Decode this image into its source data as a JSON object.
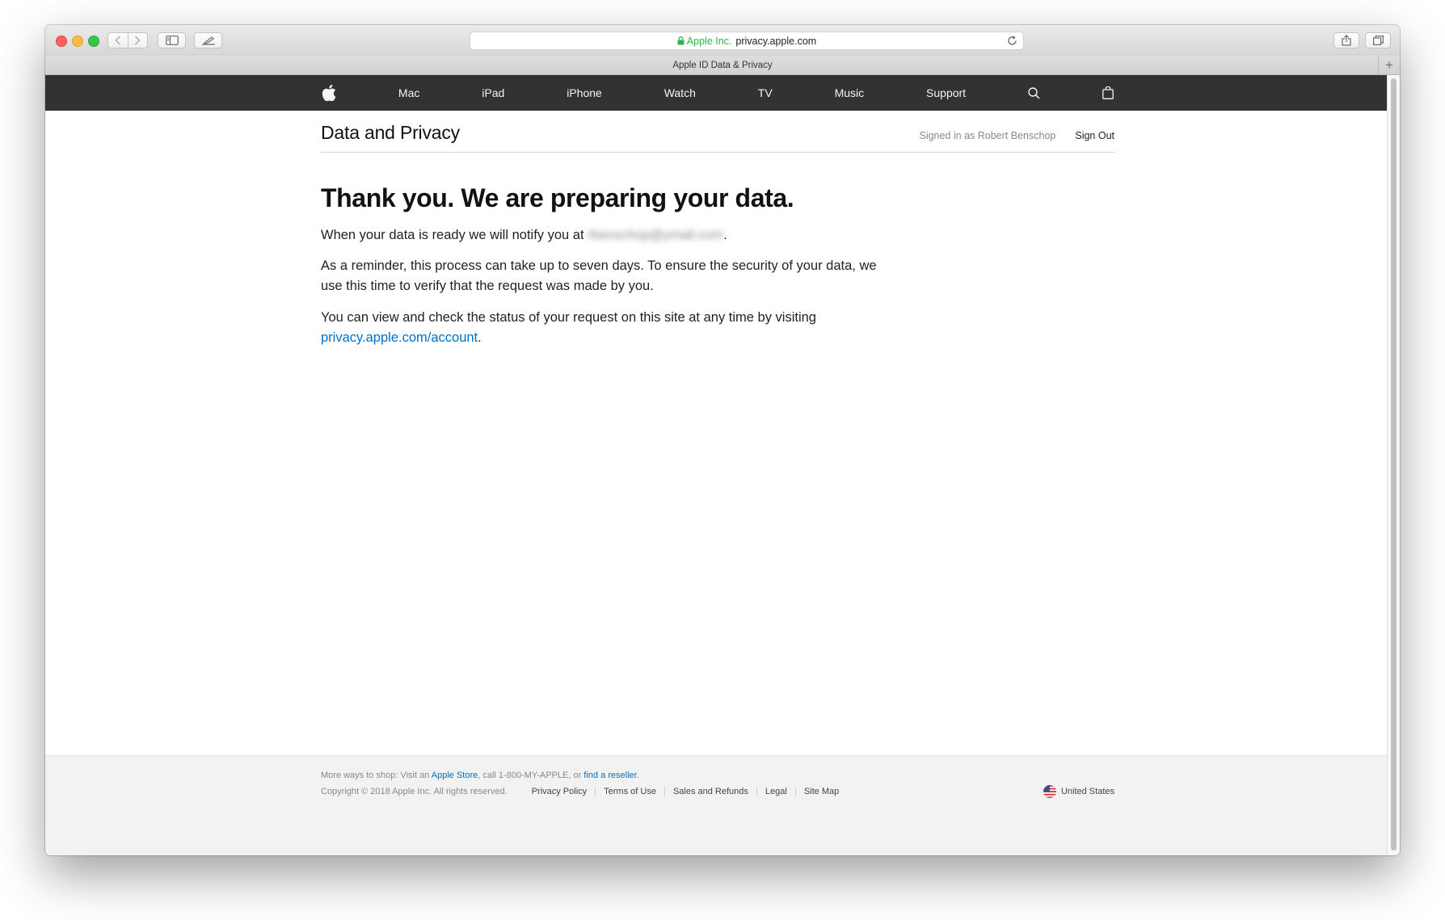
{
  "browser": {
    "address": {
      "secure_label": "Apple Inc.",
      "host": "privacy.apple.com"
    },
    "tab_title": "Apple ID Data & Privacy",
    "new_tab_symbol": "+"
  },
  "globalnav": {
    "items": [
      "Mac",
      "iPad",
      "iPhone",
      "Watch",
      "TV",
      "Music",
      "Support"
    ],
    "icons": [
      "apple-logo-icon",
      "search-icon",
      "bag-icon"
    ]
  },
  "localnav": {
    "title": "Data and Privacy",
    "signed_in": "Signed in as Robert Benschop",
    "sign_out": "Sign Out"
  },
  "main": {
    "headline": "Thank you. We are preparing your data.",
    "p1_prefix": "When your data is ready we will notify you at ",
    "p1_email": "rbenschop@ymail.com",
    "p1_suffix": ".",
    "p2": "As a reminder, this process can take up to seven days. To ensure the security of your data, we use this time to verify that the request was made by you.",
    "p3_prefix": "You can view and check the status of your request on this site at any time by visiting ",
    "p3_link": "privacy.apple.com/account",
    "p3_suffix": "."
  },
  "footer": {
    "shop_prefix": "More ways to shop: Visit an ",
    "shop_store_link": "Apple Store",
    "shop_middle": ", call 1-800-MY-APPLE, or ",
    "shop_reseller_link": "find a reseller",
    "shop_suffix": ".",
    "copyright": "Copyright © 2018 Apple Inc. All rights reserved.",
    "links": [
      "Privacy Policy",
      "Terms of Use",
      "Sales and Refunds",
      "Legal",
      "Site Map"
    ],
    "country": "United States"
  },
  "colors": {
    "nav_bg": "#323232",
    "link": "#0070c9",
    "secure_green": "#2fb44a"
  }
}
